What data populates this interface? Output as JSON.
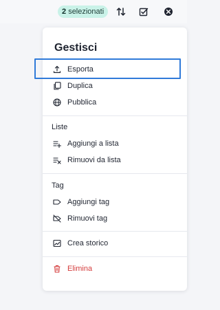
{
  "topbar": {
    "selected_count": "2",
    "selected_label": "selezionati",
    "icons": [
      "sort-icon",
      "checklist-icon",
      "close-icon"
    ]
  },
  "menu": {
    "title": "Gestisci",
    "items_top": [
      {
        "label": "Esporta",
        "icon": "upload-icon"
      },
      {
        "label": "Duplica",
        "icon": "duplicate-icon"
      },
      {
        "label": "Pubblica",
        "icon": "globe-icon"
      }
    ],
    "section_lists": "Liste",
    "items_lists": [
      {
        "label": "Aggiungi a lista",
        "icon": "playlist-add-icon"
      },
      {
        "label": "Rimuovi da lista",
        "icon": "playlist-remove-icon"
      }
    ],
    "section_tags": "Tag",
    "items_tags": [
      {
        "label": "Aggiungi tag",
        "icon": "tag-icon"
      },
      {
        "label": "Rimuovi tag",
        "icon": "tag-off-icon"
      }
    ],
    "item_history": {
      "label": "Crea storico",
      "icon": "chart-image-icon"
    },
    "item_delete": {
      "label": "Elimina",
      "icon": "trash-icon"
    }
  },
  "colors": {
    "badge_bg": "#c9f2e8",
    "highlight": "#2f7ad9",
    "danger": "#d43b3b"
  }
}
